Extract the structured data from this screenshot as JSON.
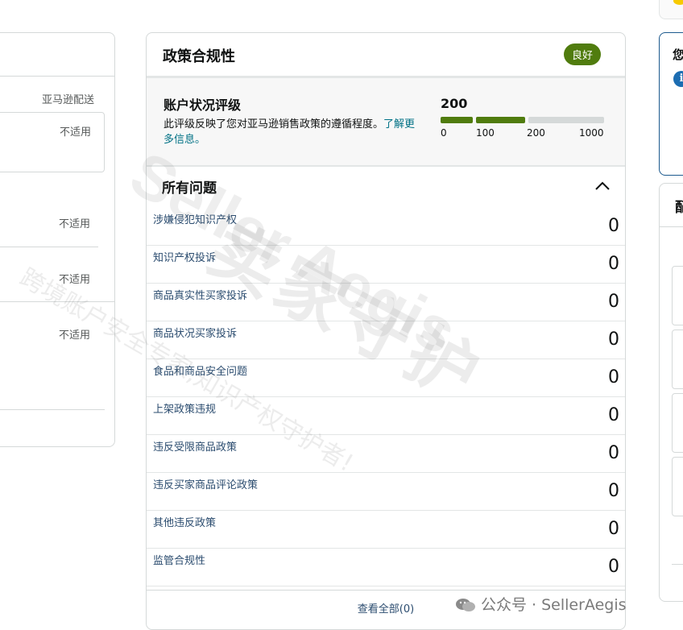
{
  "left_panel": {
    "header_right": "亚马逊配送",
    "rows": [
      {
        "value": "不适用"
      },
      {
        "value": "不适用"
      },
      {
        "value": "不适用"
      },
      {
        "value": "不适用"
      }
    ]
  },
  "policy_card": {
    "title": "政策合规性",
    "status_badge": "良好",
    "rating": {
      "title": "账户状况评级",
      "description": "此评级反映了您对亚马逊销售政策的遵循程度。",
      "link_text": "了解更多信息。",
      "score": "200",
      "score_value": 200,
      "scale_max": 1000,
      "ticks": [
        "0",
        "100",
        "200",
        "1000"
      ],
      "colors": {
        "good": "#507c0e",
        "empty": "#d5d9d9"
      }
    },
    "issues": {
      "title": "所有问题",
      "items": [
        {
          "label": "涉嫌侵犯知识产权",
          "count": "0"
        },
        {
          "label": "知识产权投诉",
          "count": "0"
        },
        {
          "label": "商品真实性买家投诉",
          "count": "0"
        },
        {
          "label": "商品状况买家投诉",
          "count": "0"
        },
        {
          "label": "食品和商品安全问题",
          "count": "0"
        },
        {
          "label": "上架政策违规",
          "count": "0"
        },
        {
          "label": "违反受限商品政策",
          "count": "0"
        },
        {
          "label": "违反买家商品评论政策",
          "count": "0"
        },
        {
          "label": "其他违反政策",
          "count": "0"
        },
        {
          "label": "监管合规性",
          "count": "0"
        }
      ]
    },
    "view_all": "查看全部(0)"
  },
  "right_panel": {
    "card1_text": "您",
    "info_icon": "info-icon",
    "card2_text": "配"
  },
  "watermark": {
    "brand_en": "Seller Aegis",
    "brand_cn": "卖家守护",
    "slogan": "跨境账户安全专家,知识产权守护者!",
    "footer": "公众号 · SellerAegis"
  }
}
